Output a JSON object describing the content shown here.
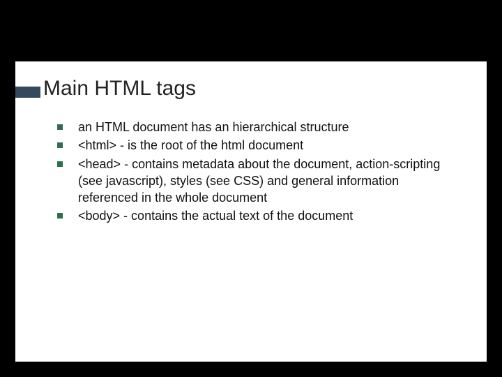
{
  "title": "Main HTML tags",
  "bullets": [
    "an HTML document has an hierarchical structure",
    "<html> - is the root of the html document",
    "<head> - contains metadata about the document, action-scripting (see javascript), styles (see CSS) and general information referenced in the whole document",
    "<body> - contains the actual text of the document"
  ],
  "colors": {
    "title_bar": "#34495e",
    "bullet": "#2f6f4f"
  }
}
